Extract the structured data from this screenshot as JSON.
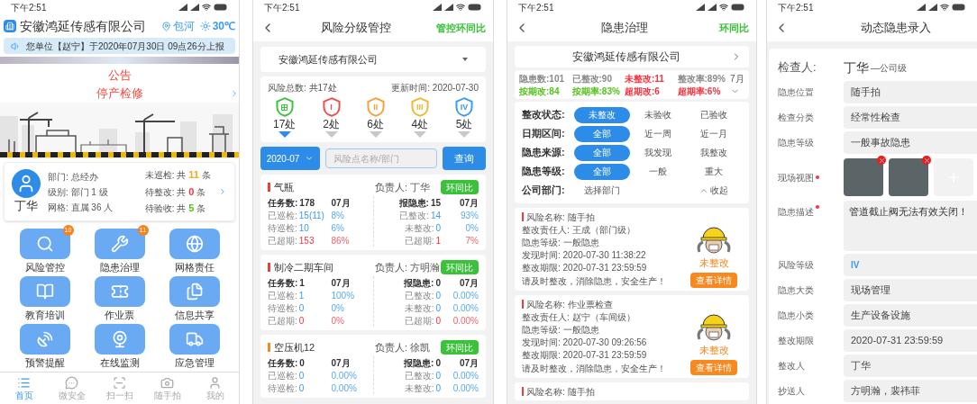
{
  "home": {
    "status_time": "下午2:51",
    "company": "安徽鸿延传感有限公司",
    "location": "包河",
    "temperature": "30℃",
    "marquee": "您单位【赵宁】于2020年07月30日 09点26分上报",
    "notice": {
      "title": "公告",
      "text": "停产检修"
    },
    "user": {
      "name": "丁华",
      "details": [
        "部门: 总经办",
        "级别: 部门 1 级",
        "网格: 直属 36 人"
      ],
      "stats": [
        {
          "label": "未巡检: 共",
          "count": "11",
          "unit": "条",
          "color": "#f5a623"
        },
        {
          "label": "待整改: 共",
          "count": "0",
          "unit": "条",
          "color": "#f5333f"
        },
        {
          "label": "待验收: 共",
          "count": "5",
          "unit": "条",
          "color": "#52c41a"
        }
      ]
    },
    "apps": [
      {
        "label": "风险管控",
        "badge": "10"
      },
      {
        "label": "隐患治理",
        "badge": "11"
      },
      {
        "label": "网格责任"
      },
      {
        "label": "教育培训"
      },
      {
        "label": "作业票"
      },
      {
        "label": "信息共享"
      },
      {
        "label": "预警提醒"
      },
      {
        "label": "在线监测"
      },
      {
        "label": "应急管理"
      }
    ],
    "tabs": [
      {
        "label": "首页",
        "selected": true
      },
      {
        "label": "微安全",
        "selected": false
      },
      {
        "label": "扫一扫",
        "selected": false
      },
      {
        "label": "随手拍",
        "selected": false
      },
      {
        "label": "我的",
        "selected": false
      }
    ]
  },
  "risk": {
    "status_time": "下午2:51",
    "title": "风险分级管控",
    "action": "管控环同比",
    "company": "安徽鸿延传感有限公司",
    "total": "风险总数: 共17处",
    "updated": "更新时间: 2020-07-30",
    "levels": [
      {
        "count": "17处",
        "color": "#3cc13b",
        "selected": true
      },
      {
        "mark": "I",
        "count": "2处",
        "color": "#f24b4b",
        "selected": false
      },
      {
        "mark": "II",
        "count": "6处",
        "color": "#f5a03a",
        "selected": false
      },
      {
        "mark": "III",
        "count": "4处",
        "color": "#f2b630",
        "selected": false
      },
      {
        "mark": "IV",
        "count": "5处",
        "color": "#3a9bf0",
        "selected": false
      }
    ],
    "month": "2020-07",
    "search_placeholder": "风险点名称/部门",
    "search_button": "查询",
    "cards": [
      {
        "name": "气瓶",
        "color": "#f23c3c",
        "owner": "负责人: 丁华",
        "button": "环同比",
        "left": [
          {
            "kind": "header",
            "label": "任务数:",
            "value": "178",
            "extra": "07月"
          },
          {
            "kind": "count",
            "label": "已巡检:",
            "value": "15(11)",
            "extra": "8%"
          },
          {
            "kind": "count",
            "label": "待巡检:",
            "value": "10",
            "extra": "6%"
          },
          {
            "kind": "overdue",
            "label": "已超期:",
            "value": "153",
            "extra": "86%"
          }
        ],
        "right": [
          {
            "kind": "header",
            "label": "报隐患:",
            "value": "15",
            "extra": "07月"
          },
          {
            "kind": "count",
            "label": "已整改:",
            "value": "14",
            "extra": "93%"
          },
          {
            "kind": "count",
            "label": "未整改:",
            "value": "0",
            "extra": "0%"
          },
          {
            "kind": "overdue",
            "label": "已超期:",
            "value": "1",
            "extra": "7%"
          }
        ]
      },
      {
        "name": "制冷二期车间",
        "color": "#f23c3c",
        "owner": "负责人: 方明瀚",
        "button": "环同比",
        "left": [
          {
            "kind": "header",
            "label": "任务数:",
            "value": "1",
            "extra": "07月"
          },
          {
            "kind": "count",
            "label": "已巡检:",
            "value": "1",
            "extra": "100%"
          },
          {
            "kind": "count",
            "label": "待巡检:",
            "value": "0",
            "extra": "0%"
          },
          {
            "kind": "overdue",
            "label": "已超期:",
            "value": "0",
            "extra": "0%"
          }
        ],
        "right": [
          {
            "kind": "header",
            "label": "报隐患:",
            "value": "0",
            "extra": "07月"
          },
          {
            "kind": "count",
            "label": "已整改:",
            "value": "0",
            "extra": "0.00%"
          },
          {
            "kind": "count",
            "label": "未整改:",
            "value": "0",
            "extra": "0.00%"
          },
          {
            "kind": "overdue",
            "label": "已超期:",
            "value": "0",
            "extra": "0.00%"
          }
        ]
      },
      {
        "name": "空压机12",
        "color": "#f5891f",
        "owner": "负责人: 徐凯",
        "button": "环同比",
        "left": [
          {
            "kind": "header",
            "label": "任务数:",
            "value": "0",
            "extra": "07月"
          },
          {
            "kind": "count",
            "label": "已巡检:",
            "value": "0",
            "extra": "0.00%"
          },
          {
            "kind": "count",
            "label": "待巡检:",
            "value": "0",
            "extra": "0.00%"
          }
        ],
        "right": [
          {
            "kind": "header",
            "label": "报隐患:",
            "value": "0",
            "extra": "07月"
          },
          {
            "kind": "count",
            "label": "已整改:",
            "value": "0",
            "extra": "0.00%"
          },
          {
            "kind": "count",
            "label": "未整改:",
            "value": "0",
            "extra": "0.00%"
          }
        ]
      }
    ]
  },
  "hazard": {
    "status_time": "下午2:51",
    "title": "隐患治理",
    "action": "环同比",
    "company": "安徽鸿延传感有限公司",
    "stats": [
      [
        {
          "text": "隐患数:101",
          "color": "#8a8a8a"
        },
        {
          "text": "已整改:90",
          "color": "#8a8a8a"
        },
        {
          "text": "未整改:11",
          "color": "#f5333f"
        },
        {
          "text": "整改率:89%",
          "color": "#8a8a8a"
        }
      ],
      [
        {
          "text": "按期改:84",
          "color": "#52c41a"
        },
        {
          "text": "按期率:83%",
          "color": "#52c41a"
        },
        {
          "text": "超期改:6",
          "color": "#f5333f"
        },
        {
          "text": "超期率:6%",
          "color": "#f5333f"
        }
      ]
    ],
    "month": "7月",
    "filters": [
      {
        "label": "整改状态:",
        "options": [
          {
            "text": "未整改",
            "selected": true
          },
          {
            "text": "未验收",
            "selected": false
          },
          {
            "text": "已验收",
            "selected": false
          }
        ]
      },
      {
        "label": "日期区间:",
        "options": [
          {
            "text": "全部",
            "selected": true
          },
          {
            "text": "近一周",
            "selected": false
          },
          {
            "text": "近一月",
            "selected": false
          }
        ]
      },
      {
        "label": "隐患来源:",
        "options": [
          {
            "text": "全部",
            "selected": true
          },
          {
            "text": "我发现",
            "selected": false
          },
          {
            "text": "我整改",
            "selected": false
          }
        ]
      },
      {
        "label": "隐患等级:",
        "options": [
          {
            "text": "全部",
            "selected": true
          },
          {
            "text": "一般",
            "selected": false
          },
          {
            "text": "重大",
            "selected": false
          }
        ]
      }
    ],
    "department": {
      "label": "公司部门:",
      "value": "选择部门"
    },
    "collapse": "收起",
    "cards": [
      {
        "name": "风险名称: 随手拍",
        "lines": [
          "整改责任人: 王成（部门级）",
          "隐患等级: 一般隐患",
          "发现时间: 2020-07-30 11:38:22",
          "整改期限: 2020-07-31 23:59:59"
        ],
        "slogan": "请及时整改，消除隐患，安全生产！",
        "status": "未整改",
        "button": "查看详情"
      },
      {
        "name": "风险名称: 作业票检查",
        "lines": [
          "整改责任人: 赵宁（车间级）",
          "隐患等级: 一般隐患",
          "发现时间: 2020-07-30 09:26:56",
          "整改期限: 2020-07-31 23:59:59"
        ],
        "slogan": "请及时整改，消除隐患，安全生产！",
        "status": "未整改",
        "button": "查看详情"
      },
      {
        "name": "风险名称: 随手拍"
      }
    ]
  },
  "entry": {
    "status_time": "下午2:51",
    "title": "动态隐患录入",
    "inspector": {
      "label": "检查人:",
      "name": "丁华",
      "level": "—公司级"
    },
    "fields": [
      {
        "kind": "text",
        "label": "隐患位置",
        "required": false,
        "value": "随手拍"
      },
      {
        "kind": "text",
        "label": "检查分类",
        "required": false,
        "value": "经常性检查"
      },
      {
        "kind": "text",
        "label": "隐患等级",
        "required": false,
        "value": "一般事故隐患"
      },
      {
        "kind": "photos",
        "label": "现场视图",
        "required": true
      },
      {
        "kind": "textarea",
        "label": "隐患描述",
        "required": true,
        "value": "管道截止阀无法有效关闭！"
      },
      {
        "kind": "level",
        "label": "风险等级",
        "required": false,
        "value": "IV"
      },
      {
        "kind": "text",
        "label": "隐患大类",
        "required": false,
        "value": "现场管理"
      },
      {
        "kind": "text",
        "label": "隐患小类",
        "required": false,
        "value": "生产设备设施"
      },
      {
        "kind": "text",
        "label": "整改期限",
        "required": false,
        "value": "2020-07-31 23:59:59"
      },
      {
        "kind": "text",
        "label": "整改人",
        "required": false,
        "value": "丁华"
      },
      {
        "kind": "text",
        "label": "抄送人",
        "required": false,
        "value": "方明瀚，裴祎菲"
      }
    ]
  }
}
